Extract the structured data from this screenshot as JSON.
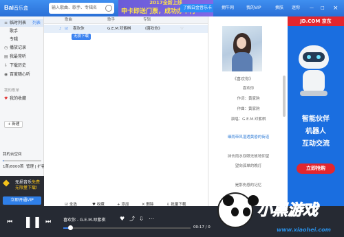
{
  "app": {
    "logo": "Bai",
    "logo_sub": "音乐盒"
  },
  "search": {
    "placeholder": "输入歌曲、歌手、专辑名"
  },
  "promo": {
    "top": "2017全新上线",
    "main": "申卡即送门票，",
    "main2": "成功办卡再",
    "button": "了解白金音乐卡"
  },
  "header": {
    "user": "拥牛网",
    "vip": "我的VIP",
    "skin": "换肤",
    "mini": "迷你",
    "min": "—",
    "max": "□",
    "close": "×"
  },
  "sidebar": {
    "items": [
      {
        "label": "临时列表",
        "badge": "列表"
      },
      {
        "label": "歌手"
      },
      {
        "label": "专辑"
      },
      {
        "label": "播放记录"
      },
      {
        "label": "我最常听"
      },
      {
        "label": "下载历史"
      },
      {
        "label": "百度随心听"
      }
    ],
    "section_label": "我的歌单",
    "fav": "我的收藏",
    "new_label": "新建",
    "cloud_left": "我的云空间",
    "cloud_right": "上传本地歌曲",
    "storage_text": "1首/8000首",
    "storage_actions": "管理 | 扩容",
    "storage_fraction": 0.02
  },
  "vip_ad": {
    "line1": "无损音乐",
    "line1b": "免费",
    "line2": "无限量下载!",
    "button": "立即开通VIP"
  },
  "list": {
    "headers": {
      "title": "歌曲",
      "artist": "歌手",
      "album": "专辑"
    },
    "rows": [
      {
        "index": "1",
        "title": "喜欢你",
        "artist": "G.E.M.邓紫棋",
        "album": "《喜欢你》"
      }
    ],
    "download_chip": "无损下载",
    "footer": {
      "select_all": "全选",
      "collect": "收藏",
      "add": "添加",
      "delete": "删除",
      "batch_download": "批量下载"
    }
  },
  "right": {
    "album": "《喜欢你》",
    "lyrics": [
      "喜欢你",
      "作词：黄家驹",
      "作曲：黄家驹",
      "演唱：G.E.M.邓紫棋",
      "细雨带风湿透黄昏的街道",
      "抹去雨水双眼无故地仰望",
      "望向孤单的晚灯",
      "是那伤感的记忆"
    ]
  },
  "ad": {
    "top": "JD.COM 京东",
    "line1": "智能伙伴",
    "line2": "机器人",
    "line3": "互动交流",
    "button": "立即抢购"
  },
  "player": {
    "now_playing": "喜欢你 - G.E.M.邓紫棋",
    "time": "00:17 / 0",
    "progress": 0.06
  },
  "watermark": {
    "title": "小黑游戏",
    "url": "www.xiaohei.com"
  }
}
